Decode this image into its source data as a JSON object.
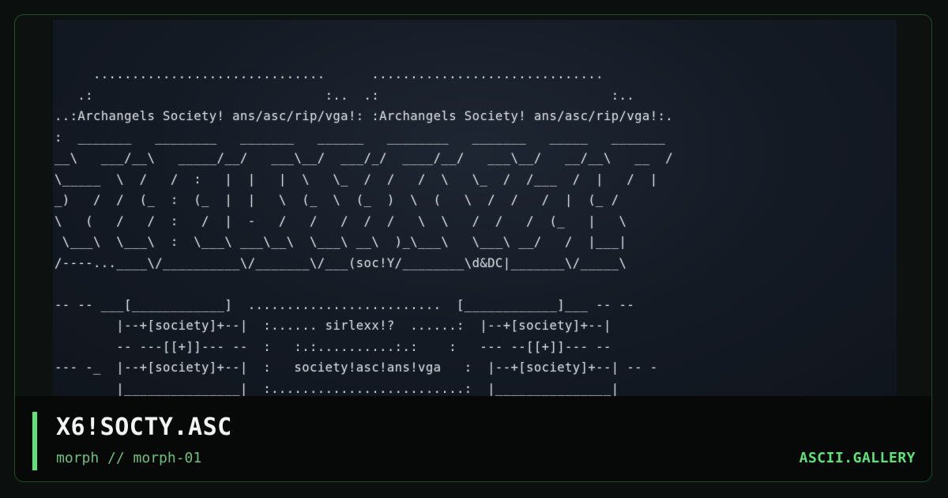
{
  "artwork": {
    "ascii": "     ..............................      ..............................\n   .:                              :..  .:                              :..\n..:Archangels Society! ans/asc/rip/vga!: :Archangels Society! ans/asc/rip/vga!:.\n:  _______   ________   _______   ______   ________   _______   _____   _______\n__\\   ___/__\\   _____/__/   ___\\__/  ___/_/  ____/__/   ___\\__/   __/__\\   __  /\n\\_____  \\  /   /  :   |  |   |  \\   \\_  /  /   /  \\   \\_  /  /___  /  |   /  |\n_)   /  /  (_  :  (_  |  |   \\  (_  \\  (_  )  \\  (   \\  /  /   /  |  (_ /\n\\   (   /   /  :   /  |  -   /   /   /  /  /   \\  \\   /  /   /  (_   |   \\\n \\___\\  \\___\\  :  \\___\\ ___\\__\\  \\___\\ __\\  )_\\___\\   \\___\\ __/   /  |___|\n/----...____\\/__________\\/_______\\/___(soc!Y/________\\d&DC|_______\\/_____\\\n\n-- -- ___[____________]  .........................  [____________]___ -- --\n        |--+[society]+--|  :...... sirlexx!?  ......:  |--+[society]+--|\n        -- ---[[+]]--- --  :   :.:..........:.:    :   --- --[[+]]--- --\n--- -_  |--+[society]+--|  :   society!asc!ans!vga   :  |--+[society]+--| -- -\n        |_______________|  :.........................:  |_______________|"
  },
  "caption": {
    "title": "X6!SOCTY.ASC",
    "subtitle": "morph // morph-01",
    "brand": "ASCII.GALLERY"
  },
  "colors": {
    "accent": "#5ee37a",
    "subtitle": "#6fbf7e",
    "title": "#f2f4f3",
    "art_background": "#161c26",
    "card_border": "#1f4d2c"
  }
}
